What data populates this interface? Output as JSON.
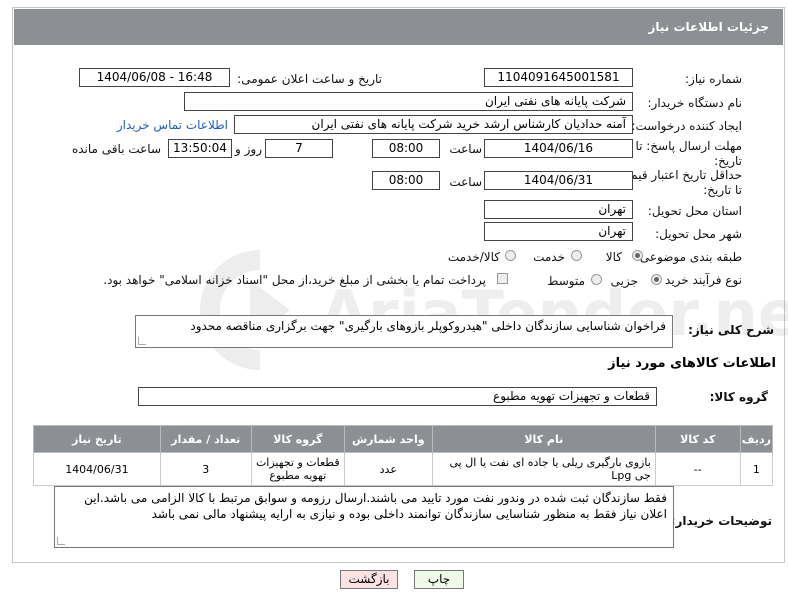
{
  "header": {
    "title": "جزئیات اطلاعات نیاز"
  },
  "fields": {
    "need_number_label": "شماره نیاز:",
    "need_number": "1104091645001581",
    "announce_label": "تاریخ و ساعت اعلان عمومی:",
    "announce_value": "1404/06/08 - 16:48",
    "buyer_org_label": "نام دستگاه خریدار:",
    "buyer_org": "شرکت پایانه های نفتی ایران",
    "creator_label": "ایجاد کننده درخواست:",
    "creator": "آمنه  حدادیان  کارشناس ارشد خرید  شرکت پایانه های نفتی ایران",
    "contact_link": "اطلاعات تماس خریدار",
    "deadline_label_1": "مهلت ارسال پاسخ: تا",
    "deadline_label_2": "تاریخ:",
    "deadline_date": "1404/06/16",
    "time_label": "ساعت",
    "deadline_time": "08:00",
    "days_value": "7",
    "days_label": "روز و",
    "remaining_time": "13:50:04",
    "remaining_label": "ساعت باقی مانده",
    "validity_label_1": "حداقل تاریخ اعتبار قیمت:",
    "validity_label_2": "تا تاریخ:",
    "validity_date": "1404/06/31",
    "validity_time": "08:00",
    "province_label": "استان محل تحویل:",
    "province": "تهران",
    "city_label": "شهر محل تحویل:",
    "city": "تهران",
    "category_label": "طبقه بندی موضوعی:",
    "category_options": [
      "کالا",
      "خدمت",
      "کالا/خدمت"
    ],
    "process_label": "نوع فرآیند خرید :",
    "process_options": [
      "جزیی",
      "متوسط"
    ],
    "payment_note": "پرداخت تمام یا بخشی از مبلغ خرید،از محل \"اسناد خزانه اسلامی\" خواهد بود."
  },
  "description": {
    "label": "شرح کلی نیاز:",
    "text": "فراخوان شناسایی سازندگان داخلی \"هیدروکوپلر بازوهای بارگیری\" جهت برگزاری مناقصه محدود"
  },
  "goods": {
    "title": "اطلاعات کالاهای مورد نیاز",
    "group_label": "گروه کالا:",
    "group_value": "قطعات و تجهیزات تهویه مطبوع",
    "columns": [
      "ردیف",
      "کد کالا",
      "نام کالا",
      "واحد شمارش",
      "گروه کالا",
      "تعداد / مقدار",
      "تاریخ نیاز"
    ],
    "rows": [
      {
        "row": "1",
        "code": "--",
        "name": "بازوی بارگیری ریلی یا جاده ای نفت یا ال پی جی Lpg",
        "unit": "عدد",
        "group": "قطعات و تجهیزات تهویه مطبوع",
        "qty": "3",
        "date": "1404/06/31"
      }
    ]
  },
  "buyer_notes": {
    "label": "توضیحات خریدار:",
    "text": "فقط سازندگان ثبت شده در وندور نفت مورد تایید می باشند.ارسال رزومه و سوابق مرتبط با کالا الزامی می باشد.این اعلان نیاز فقط به منظور شناسایی سازندگان توانمند داخلی بوده و نیازی به ارایه پیشنهاد مالی نمی باشد"
  },
  "buttons": {
    "print": "چاپ",
    "back": "بازگشت"
  },
  "watermark": {
    "text": "AriaTender.net"
  },
  "colors": {
    "header_bg": "#8c8f94",
    "link": "#1f5fbf",
    "back_btn_bg": "#fbe3e3",
    "print_btn_bg": "#eef9e8"
  }
}
